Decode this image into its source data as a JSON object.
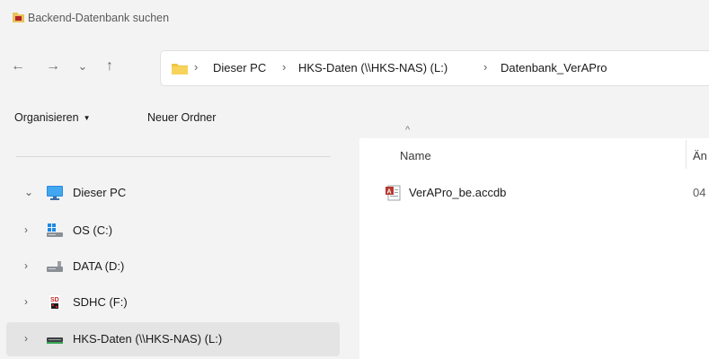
{
  "window": {
    "title": "Backend-Datenbank suchen",
    "title_icon": "access-folder-icon"
  },
  "nav": {
    "back_icon": "arrow-left-icon",
    "forward_icon": "arrow-right-icon",
    "recent_icon": "chevron-down-icon",
    "up_icon": "arrow-up-icon"
  },
  "breadcrumb": {
    "separator": "›",
    "items": [
      "Dieser PC",
      "HKS-Daten (\\\\HKS-NAS) (L:)",
      "Datenbank_VerAPro"
    ]
  },
  "toolbar": {
    "organize": "Organisieren",
    "new_folder": "Neuer Ordner",
    "organize_caret": "▼"
  },
  "sidebar": {
    "items": [
      {
        "label": "Dieser PC",
        "icon": "monitor-icon",
        "expanded": true
      },
      {
        "label": "OS (C:)",
        "icon": "windows-drive-icon",
        "expanded": false
      },
      {
        "label": "DATA (D:)",
        "icon": "drive-icon",
        "expanded": false
      },
      {
        "label": "SDHC (F:)",
        "icon": "sd-card-icon",
        "expanded": false
      },
      {
        "label": "HKS-Daten (\\\\HKS-NAS) (L:)",
        "icon": "network-drive-icon",
        "expanded": false,
        "selected": true
      }
    ],
    "chevron_collapsed": "›",
    "chevron_expanded": "⌄"
  },
  "file_list": {
    "sort_indicator": "^",
    "columns": [
      "Name",
      "Än"
    ],
    "rows": [
      {
        "name": "VerAPro_be.accdb",
        "date": "04",
        "icon": "access-db-icon"
      }
    ]
  }
}
